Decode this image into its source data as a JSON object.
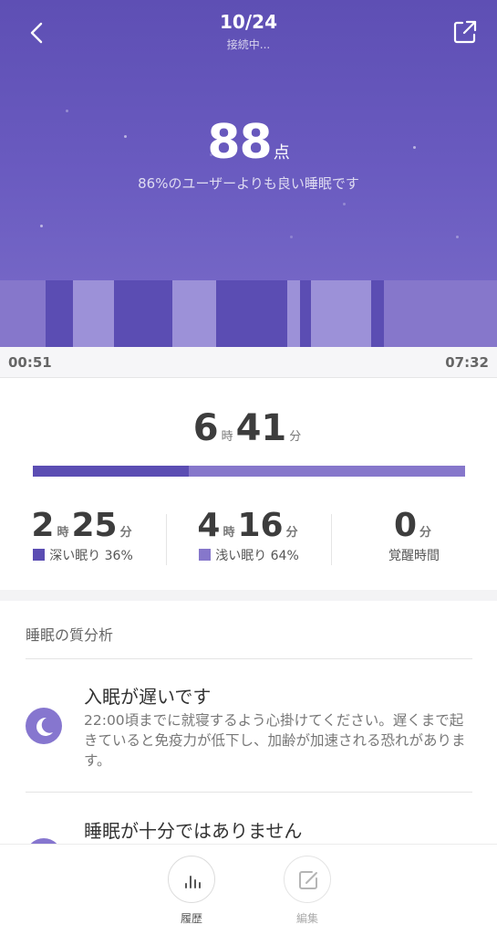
{
  "header": {
    "date": "10/24",
    "status": "接続中...",
    "score": "88",
    "score_unit": "点",
    "comparison": "86%のユーザーよりも良い睡眠です"
  },
  "timeline": {
    "start": "00:51",
    "end": "07:32"
  },
  "total": {
    "hours": "6",
    "hours_unit": "時",
    "minutes": "41",
    "minutes_unit": "分",
    "deep_fraction": 0.36
  },
  "stats": {
    "deep": {
      "hours": "2",
      "hours_unit": "時",
      "minutes": "25",
      "minutes_unit": "分",
      "label": "深い眠り 36%"
    },
    "light": {
      "hours": "4",
      "hours_unit": "時",
      "minutes": "16",
      "minutes_unit": "分",
      "label": "浅い眠り 64%"
    },
    "awake": {
      "minutes": "0",
      "minutes_unit": "分",
      "label": "覚醒時間"
    }
  },
  "analysis": {
    "title": "睡眠の質分析",
    "items": [
      {
        "title": "入眠が遅いです",
        "body": "22:00頃までに就寝するよう心掛けてください。遅くまで起きていると免疫力が低下し、加齢が加速される恐れがあります。",
        "icon": "moon-icon"
      },
      {
        "title": "睡眠が十分ではありません",
        "icon": "moon-icon"
      }
    ]
  },
  "bottom_nav": {
    "history_label": "履歴",
    "edit_label": "編集"
  },
  "colors": {
    "deep": "#5b4db3",
    "light": "#8677cb",
    "accent": "#6a5bc0"
  }
}
